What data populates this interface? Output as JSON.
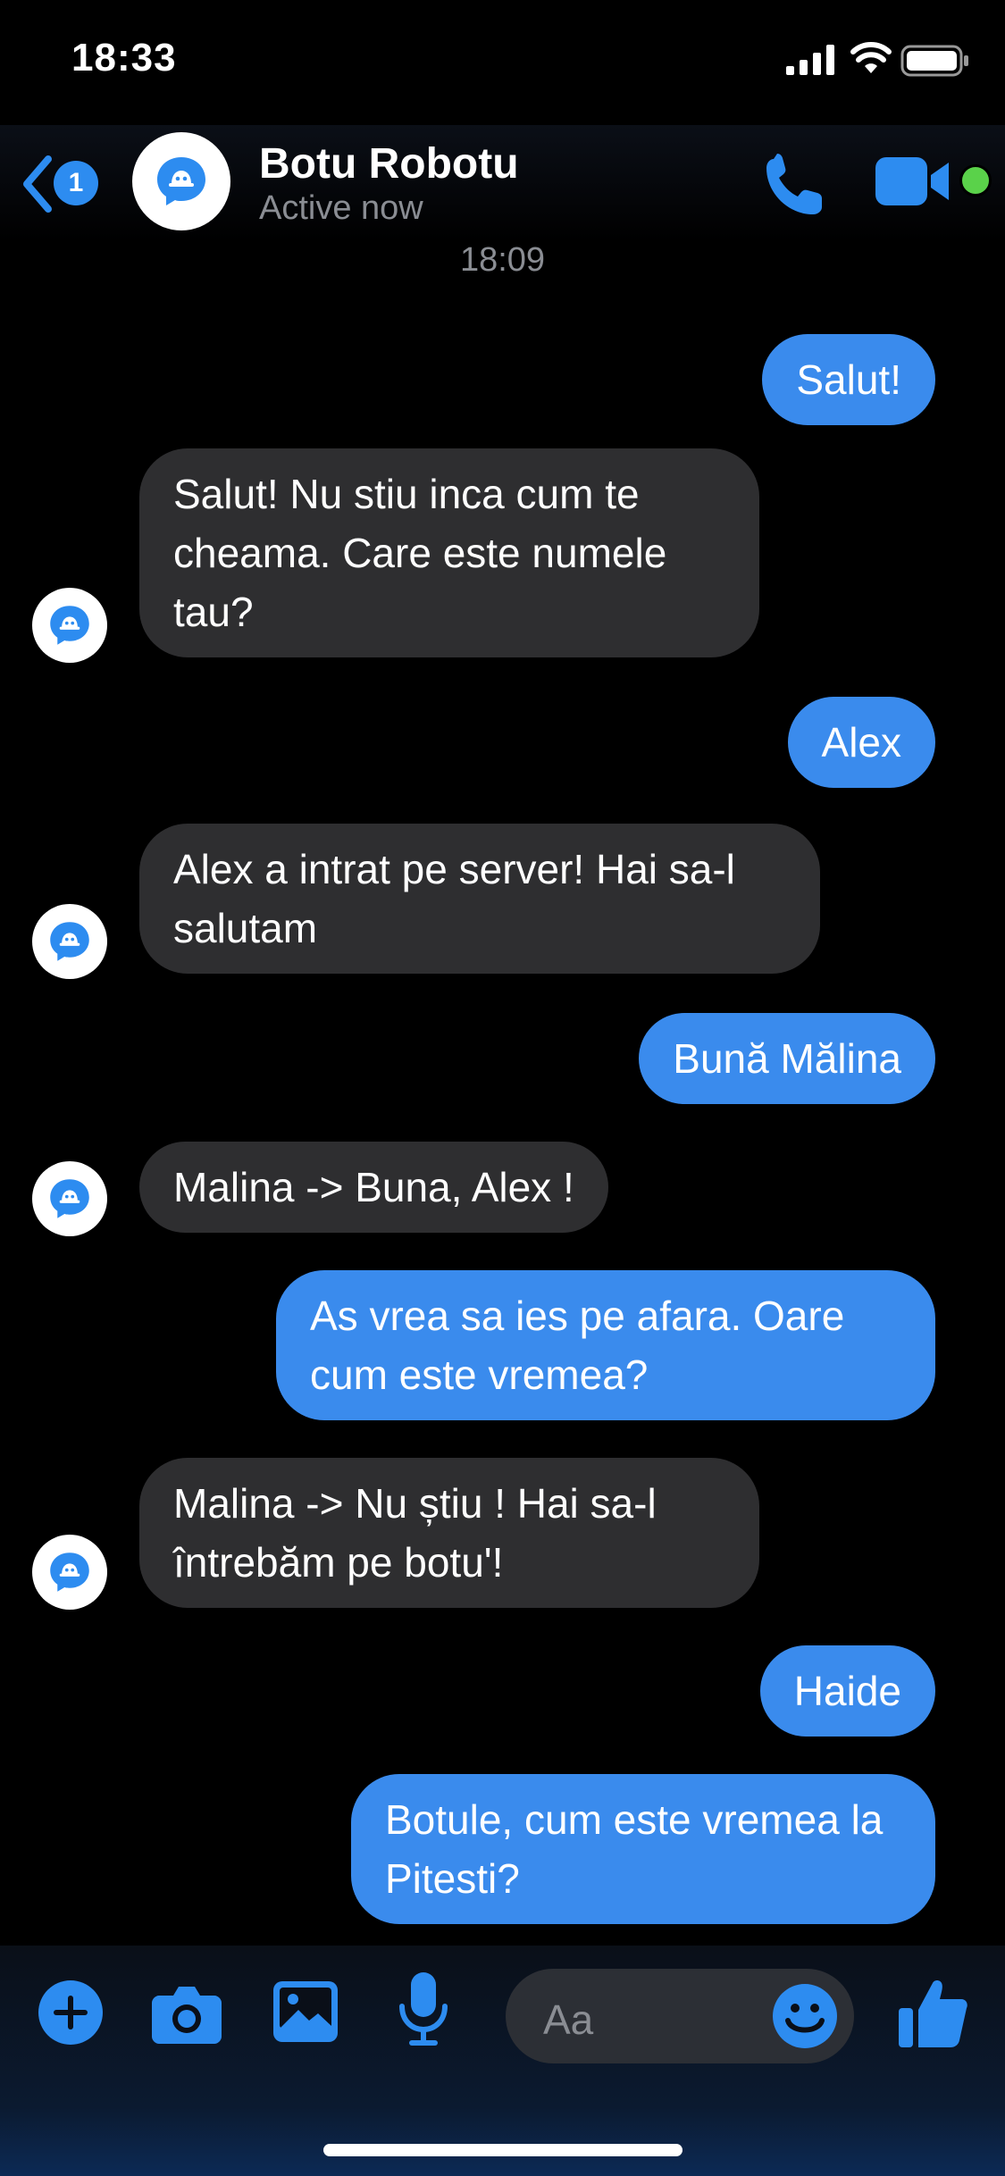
{
  "status_bar": {
    "time": "18:33"
  },
  "header": {
    "back_badge": "1",
    "contact_name": "Botu Robotu",
    "status": "Active now"
  },
  "conversation": {
    "timestamp": "18:09",
    "messages": [
      {
        "sender": "me",
        "text": "Salut!"
      },
      {
        "sender": "bot",
        "text": "Salut! Nu stiu inca cum te cheama. Care este numele tau?"
      },
      {
        "sender": "me",
        "text": "Alex"
      },
      {
        "sender": "bot",
        "text": "Alex a intrat pe server! Hai sa-l salutam"
      },
      {
        "sender": "me",
        "text": "Bună Mălina"
      },
      {
        "sender": "bot",
        "text": "Malina -> Buna, Alex !"
      },
      {
        "sender": "me",
        "text": "As vrea sa ies pe afara. Oare cum este vremea?"
      },
      {
        "sender": "bot",
        "text": "Malina -> Nu știu ! Hai sa-l întrebăm pe botu'!"
      },
      {
        "sender": "me",
        "text": "Haide"
      },
      {
        "sender": "me",
        "text": "Botule, cum este vremea la Pitesti?"
      }
    ]
  },
  "composer": {
    "placeholder": "Aa"
  },
  "colors": {
    "accent": "#3a8bed",
    "bot_bubble": "#2e2e30",
    "online": "#5ad24a"
  },
  "icons": [
    "back-chevron-icon",
    "phone-icon",
    "video-camera-icon",
    "plus-icon",
    "camera-icon",
    "photo-icon",
    "microphone-icon",
    "emoji-icon",
    "thumbs-up-icon",
    "bot-avatar-icon"
  ]
}
